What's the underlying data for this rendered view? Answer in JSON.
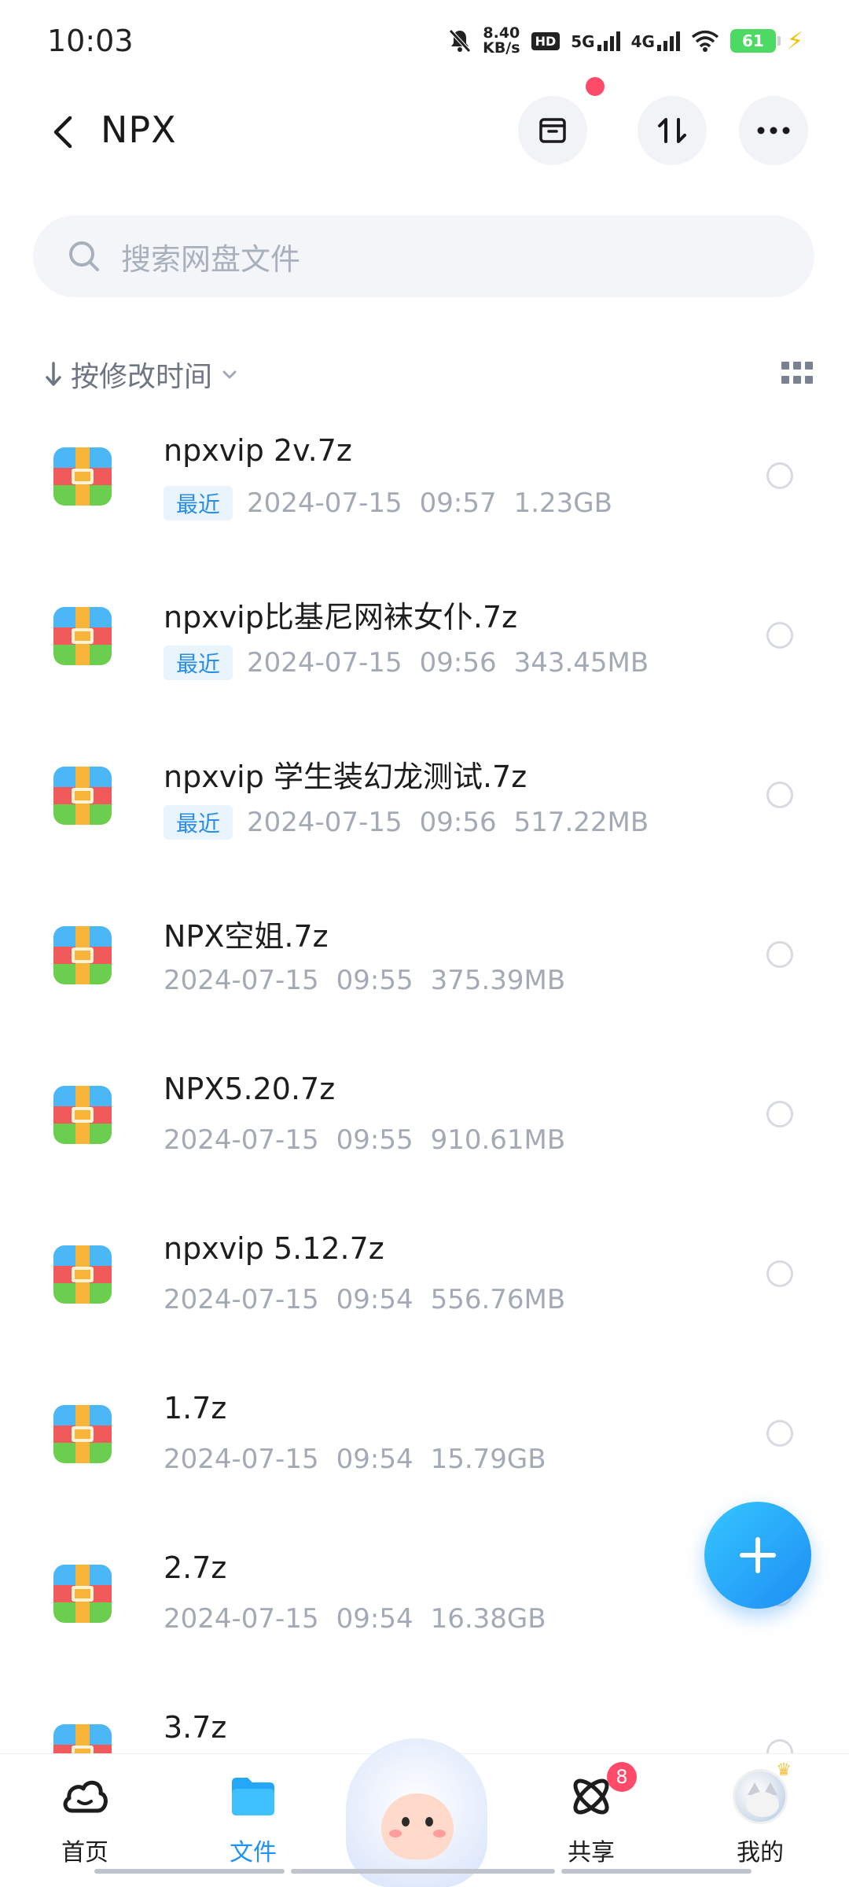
{
  "status_bar": {
    "time": "10:03",
    "net_speed_value": "8.40",
    "net_speed_unit": "KB/s",
    "sim1": "5G",
    "sim2": "4G",
    "battery": "61",
    "colors": {
      "battery": "#4cd964",
      "charging": "#f2c200"
    }
  },
  "header": {
    "title": "NPX",
    "icons": {
      "back": "back-arrow-icon",
      "archive": "archive-box-icon",
      "transfer": "transfer-arrows-icon",
      "more": "more-dots-icon"
    },
    "notification_dot": true
  },
  "search": {
    "placeholder": "搜索网盘文件",
    "icon": "search-icon"
  },
  "sort": {
    "label": "按修改时间",
    "icon": "sort-down-arrow-icon",
    "view_icon": "grid-view-icon"
  },
  "files": [
    {
      "name": "npxvip 2v.7z",
      "badge": "最近",
      "date": "2024-07-15",
      "time": "09:57",
      "size": "1.23GB"
    },
    {
      "name": "npxvip比基尼网袜女仆.7z",
      "badge": "最近",
      "date": "2024-07-15",
      "time": "09:56",
      "size": "343.45MB"
    },
    {
      "name": "npxvip  学生装幻龙测试.7z",
      "badge": "最近",
      "date": "2024-07-15",
      "time": "09:56",
      "size": "517.22MB"
    },
    {
      "name": "NPX空姐.7z",
      "badge": "",
      "date": "2024-07-15",
      "time": "09:55",
      "size": "375.39MB"
    },
    {
      "name": "NPX5.20.7z",
      "badge": "",
      "date": "2024-07-15",
      "time": "09:55",
      "size": "910.61MB"
    },
    {
      "name": "npxvip 5.12.7z",
      "badge": "",
      "date": "2024-07-15",
      "time": "09:54",
      "size": "556.76MB"
    },
    {
      "name": "1.7z",
      "badge": "",
      "date": "2024-07-15",
      "time": "09:54",
      "size": "15.79GB"
    },
    {
      "name": "2.7z",
      "badge": "",
      "date": "2024-07-15",
      "time": "09:54",
      "size": "16.38GB"
    },
    {
      "name": "3.7z",
      "badge": "",
      "date": "",
      "time": "",
      "size": ""
    }
  ],
  "fab": {
    "icon": "plus-icon",
    "color": "#1e8df4"
  },
  "bottom_nav": {
    "home": "首页",
    "files": "文件",
    "share": "共享",
    "share_badge": "8",
    "mine": "我的",
    "active": "files",
    "colors": {
      "active": "#1f93f2",
      "badge": "#ff4a6a"
    }
  }
}
